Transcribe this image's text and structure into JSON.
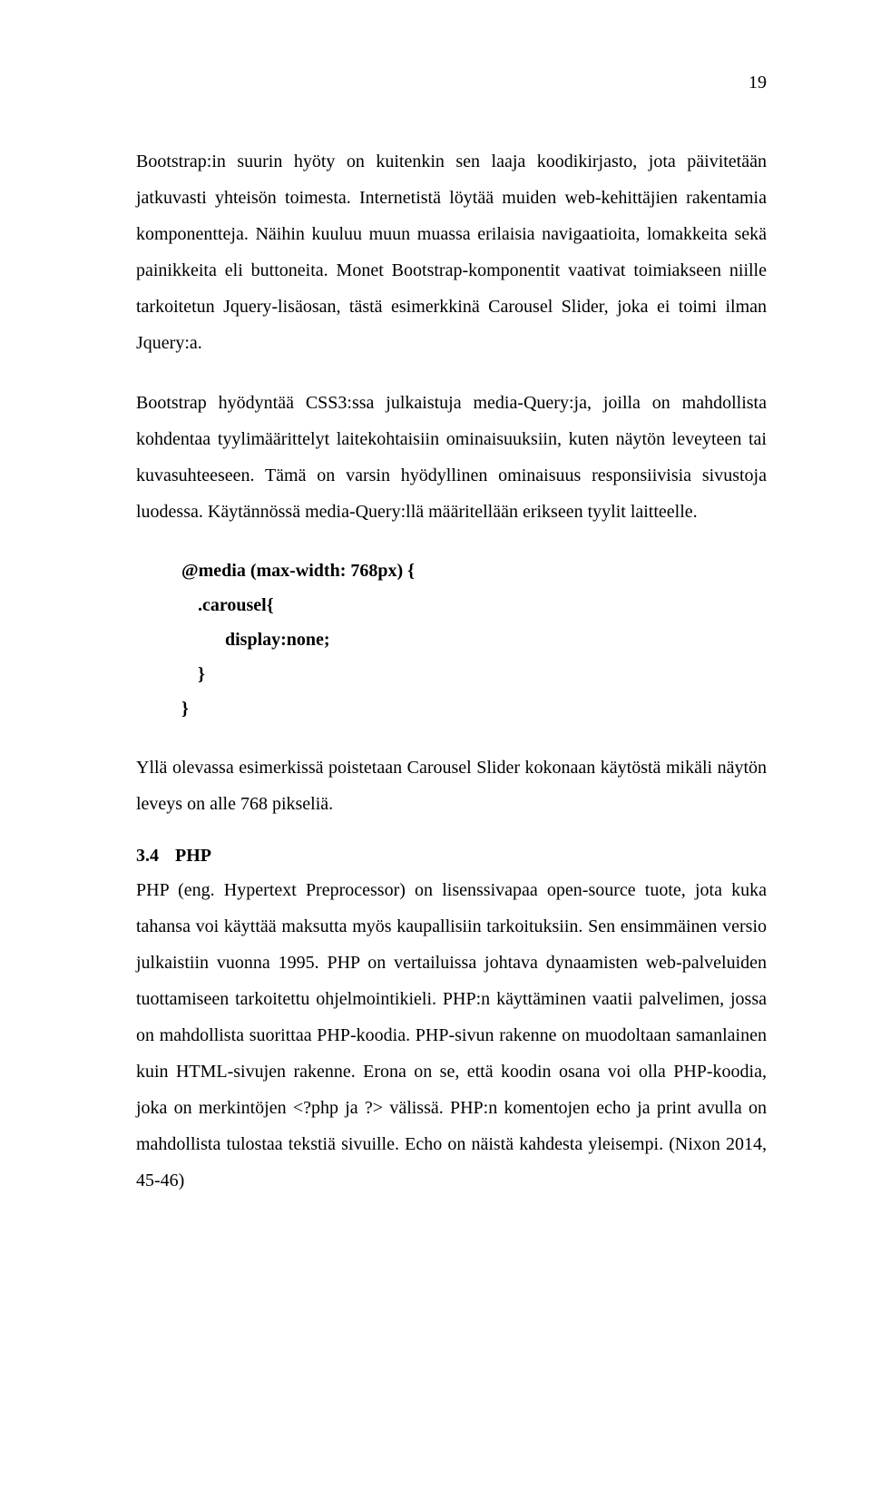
{
  "page_number": "19",
  "paragraphs": {
    "p1": "Bootstrap:in suurin hyöty on kuitenkin sen laaja koodikirjasto, jota päivitetään jatkuvasti yhteisön toimesta. Internetistä löytää muiden web-kehittäjien rakentamia komponentteja. Näihin kuuluu muun muassa erilaisia navigaatioita, lomakkeita sekä painikkeita eli buttoneita. Monet Bootstrap-komponentit vaativat toimiakseen niille tarkoitetun Jquery-lisäosan, tästä esimerkkinä Carousel Slider, joka ei toimi ilman Jquery:a.",
    "p2": "Bootstrap hyödyntää CSS3:ssa julkaistuja media-Query:ja, joilla on mahdollista kohdentaa tyylimäärittelyt laitekohtaisiin ominaisuuksiin, kuten näytön leveyteen tai kuvasuhteeseen. Tämä on varsin hyödyllinen ominaisuus responsiivisia sivustoja luodessa. Käytännössä media-Query:llä määritellään erikseen tyylit laitteelle.",
    "p3": "Yllä olevassa esimerkissä poistetaan Carousel Slider kokonaan käytöstä mikäli näytön leveys on alle 768 pikseliä.",
    "p4": "PHP (eng. Hypertext Preprocessor) on lisenssivapaa open-source tuote, jota kuka tahansa voi käyttää maksutta myös kaupallisiin tarkoituksiin. Sen ensimmäinen versio julkaistiin vuonna 1995. PHP on vertailuissa johtava dynaamisten web-palveluiden tuottamiseen tarkoitettu ohjelmointikieli. PHP:n käyttäminen vaatii palvelimen, jossa on mahdollista suorittaa PHP-koodia. PHP-sivun rakenne on muodoltaan samanlainen kuin HTML-sivujen rakenne. Erona on se, että koodin osana voi olla PHP-koodia, joka on merkintöjen <?php ja ?> välissä. PHP:n komentojen echo ja print avulla on mahdollista tulostaa tekstiä sivuille. Echo on näistä kahdesta yleisempi. (Nixon 2014, 45-46)"
  },
  "code": {
    "l1": "@media (max-width: 768px) {",
    "l2": ".carousel{",
    "l3": "display:none;",
    "l4": "}",
    "l5": "}"
  },
  "section": {
    "number": "3.4",
    "title": "PHP"
  }
}
